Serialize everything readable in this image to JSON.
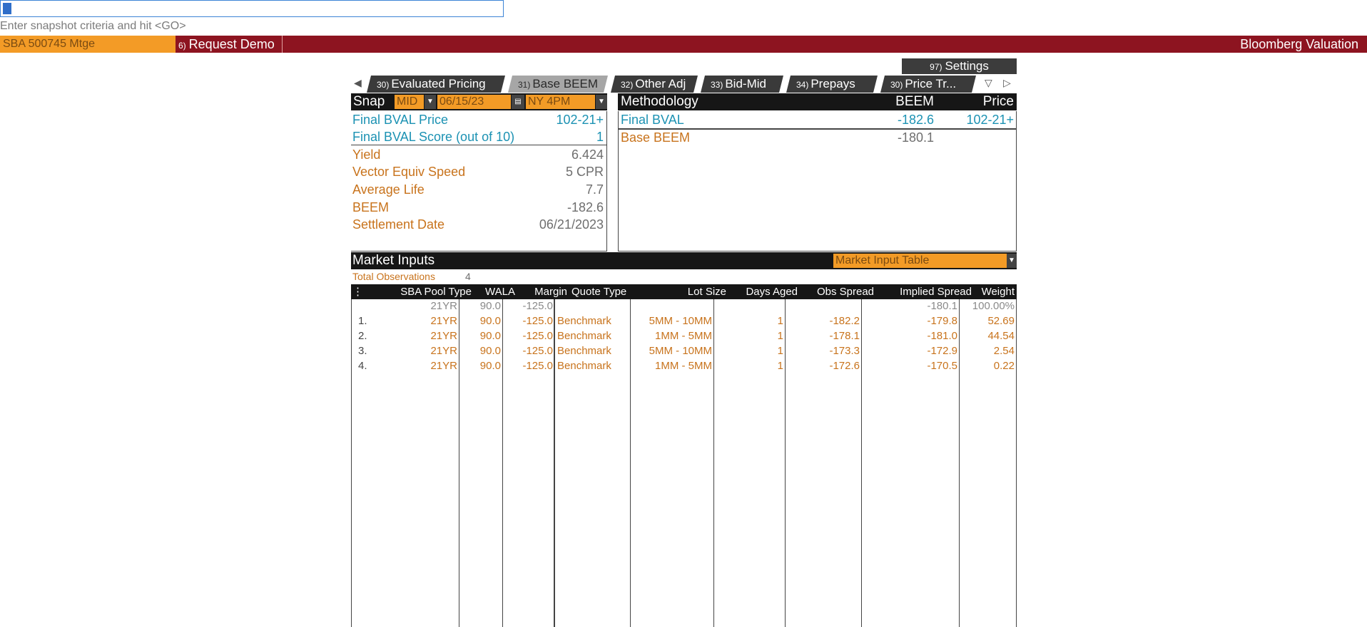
{
  "command_line": {
    "hint": "Enter snapshot criteria and hit <GO>"
  },
  "header": {
    "security": "SBA 500745 Mtge",
    "demo_num": "6)",
    "demo_label": "Request Demo",
    "brand": "Bloomberg Valuation"
  },
  "settings": {
    "num": "97)",
    "label": "Settings"
  },
  "tabs": [
    {
      "num": "30)",
      "label": "Evaluated Pricing"
    },
    {
      "num": "31)",
      "label": "Base BEEM"
    },
    {
      "num": "32)",
      "label": "Other Adj"
    },
    {
      "num": "33)",
      "label": "Bid-Mid"
    },
    {
      "num": "34)",
      "label": "Prepays"
    },
    {
      "num": "30)",
      "label": "Price Tr..."
    }
  ],
  "snap": {
    "label": "Snap",
    "source": "MID",
    "date": "06/15/23",
    "time": "NY 4PM"
  },
  "summary": {
    "final_price_label": "Final BVAL Price",
    "final_price_value": "102-21+",
    "final_score_label": "Final BVAL Score (out of 10)",
    "final_score_value": "1",
    "yield_label": "Yield",
    "yield_value": "6.424",
    "vector_label": "Vector Equiv Speed",
    "vector_value": "5 CPR",
    "avglife_label": "Average Life",
    "avglife_value": "7.7",
    "beem_label": "BEEM",
    "beem_value": "-182.6",
    "settle_label": "Settlement Date",
    "settle_value": "06/21/2023"
  },
  "methodology": {
    "header": {
      "col1": "Methodology",
      "col2": "BEEM",
      "col3": "Price"
    },
    "rows": [
      {
        "name": "Final BVAL",
        "beem": "-182.6",
        "price": "102-21+"
      },
      {
        "name": "Base BEEM",
        "beem": "-180.1",
        "price": ""
      }
    ]
  },
  "market_inputs": {
    "title": "Market Inputs",
    "dropdown": "Market Input Table",
    "total_obs_label": "Total Observations",
    "total_obs_value": "4",
    "columns": [
      "SBA Pool Type",
      "WALA",
      "Margin",
      "Quote Type",
      "Lot Size",
      "Days Aged",
      "Obs Spread",
      "Implied Spread",
      "Weight"
    ],
    "summary_row": {
      "idx": "",
      "pool": "21YR",
      "wala": "90.0",
      "margin": "-125.0",
      "quote": "",
      "lot": "",
      "days": "",
      "obs": "",
      "implied": "-180.1",
      "weight": "100.00%"
    },
    "rows": [
      {
        "idx": "1.",
        "pool": "21YR",
        "wala": "90.0",
        "margin": "-125.0",
        "quote": "Benchmark",
        "lot": "5MM - 10MM",
        "days": "1",
        "obs": "-182.2",
        "implied": "-179.8",
        "weight": "52.69"
      },
      {
        "idx": "2.",
        "pool": "21YR",
        "wala": "90.0",
        "margin": "-125.0",
        "quote": "Benchmark",
        "lot": "1MM - 5MM",
        "days": "1",
        "obs": "-178.1",
        "implied": "-181.0",
        "weight": "44.54"
      },
      {
        "idx": "3.",
        "pool": "21YR",
        "wala": "90.0",
        "margin": "-125.0",
        "quote": "Benchmark",
        "lot": "5MM - 10MM",
        "days": "1",
        "obs": "-173.3",
        "implied": "-172.9",
        "weight": "2.54"
      },
      {
        "idx": "4.",
        "pool": "21YR",
        "wala": "90.0",
        "margin": "-125.0",
        "quote": "Benchmark",
        "lot": "1MM - 5MM",
        "days": "1",
        "obs": "-172.6",
        "implied": "-170.5",
        "weight": "0.22"
      }
    ]
  },
  "colors": {
    "header_red": "#8d1420",
    "amber": "#f39b26",
    "label_orange": "#c8731c",
    "label_blue": "#1c92b3"
  }
}
